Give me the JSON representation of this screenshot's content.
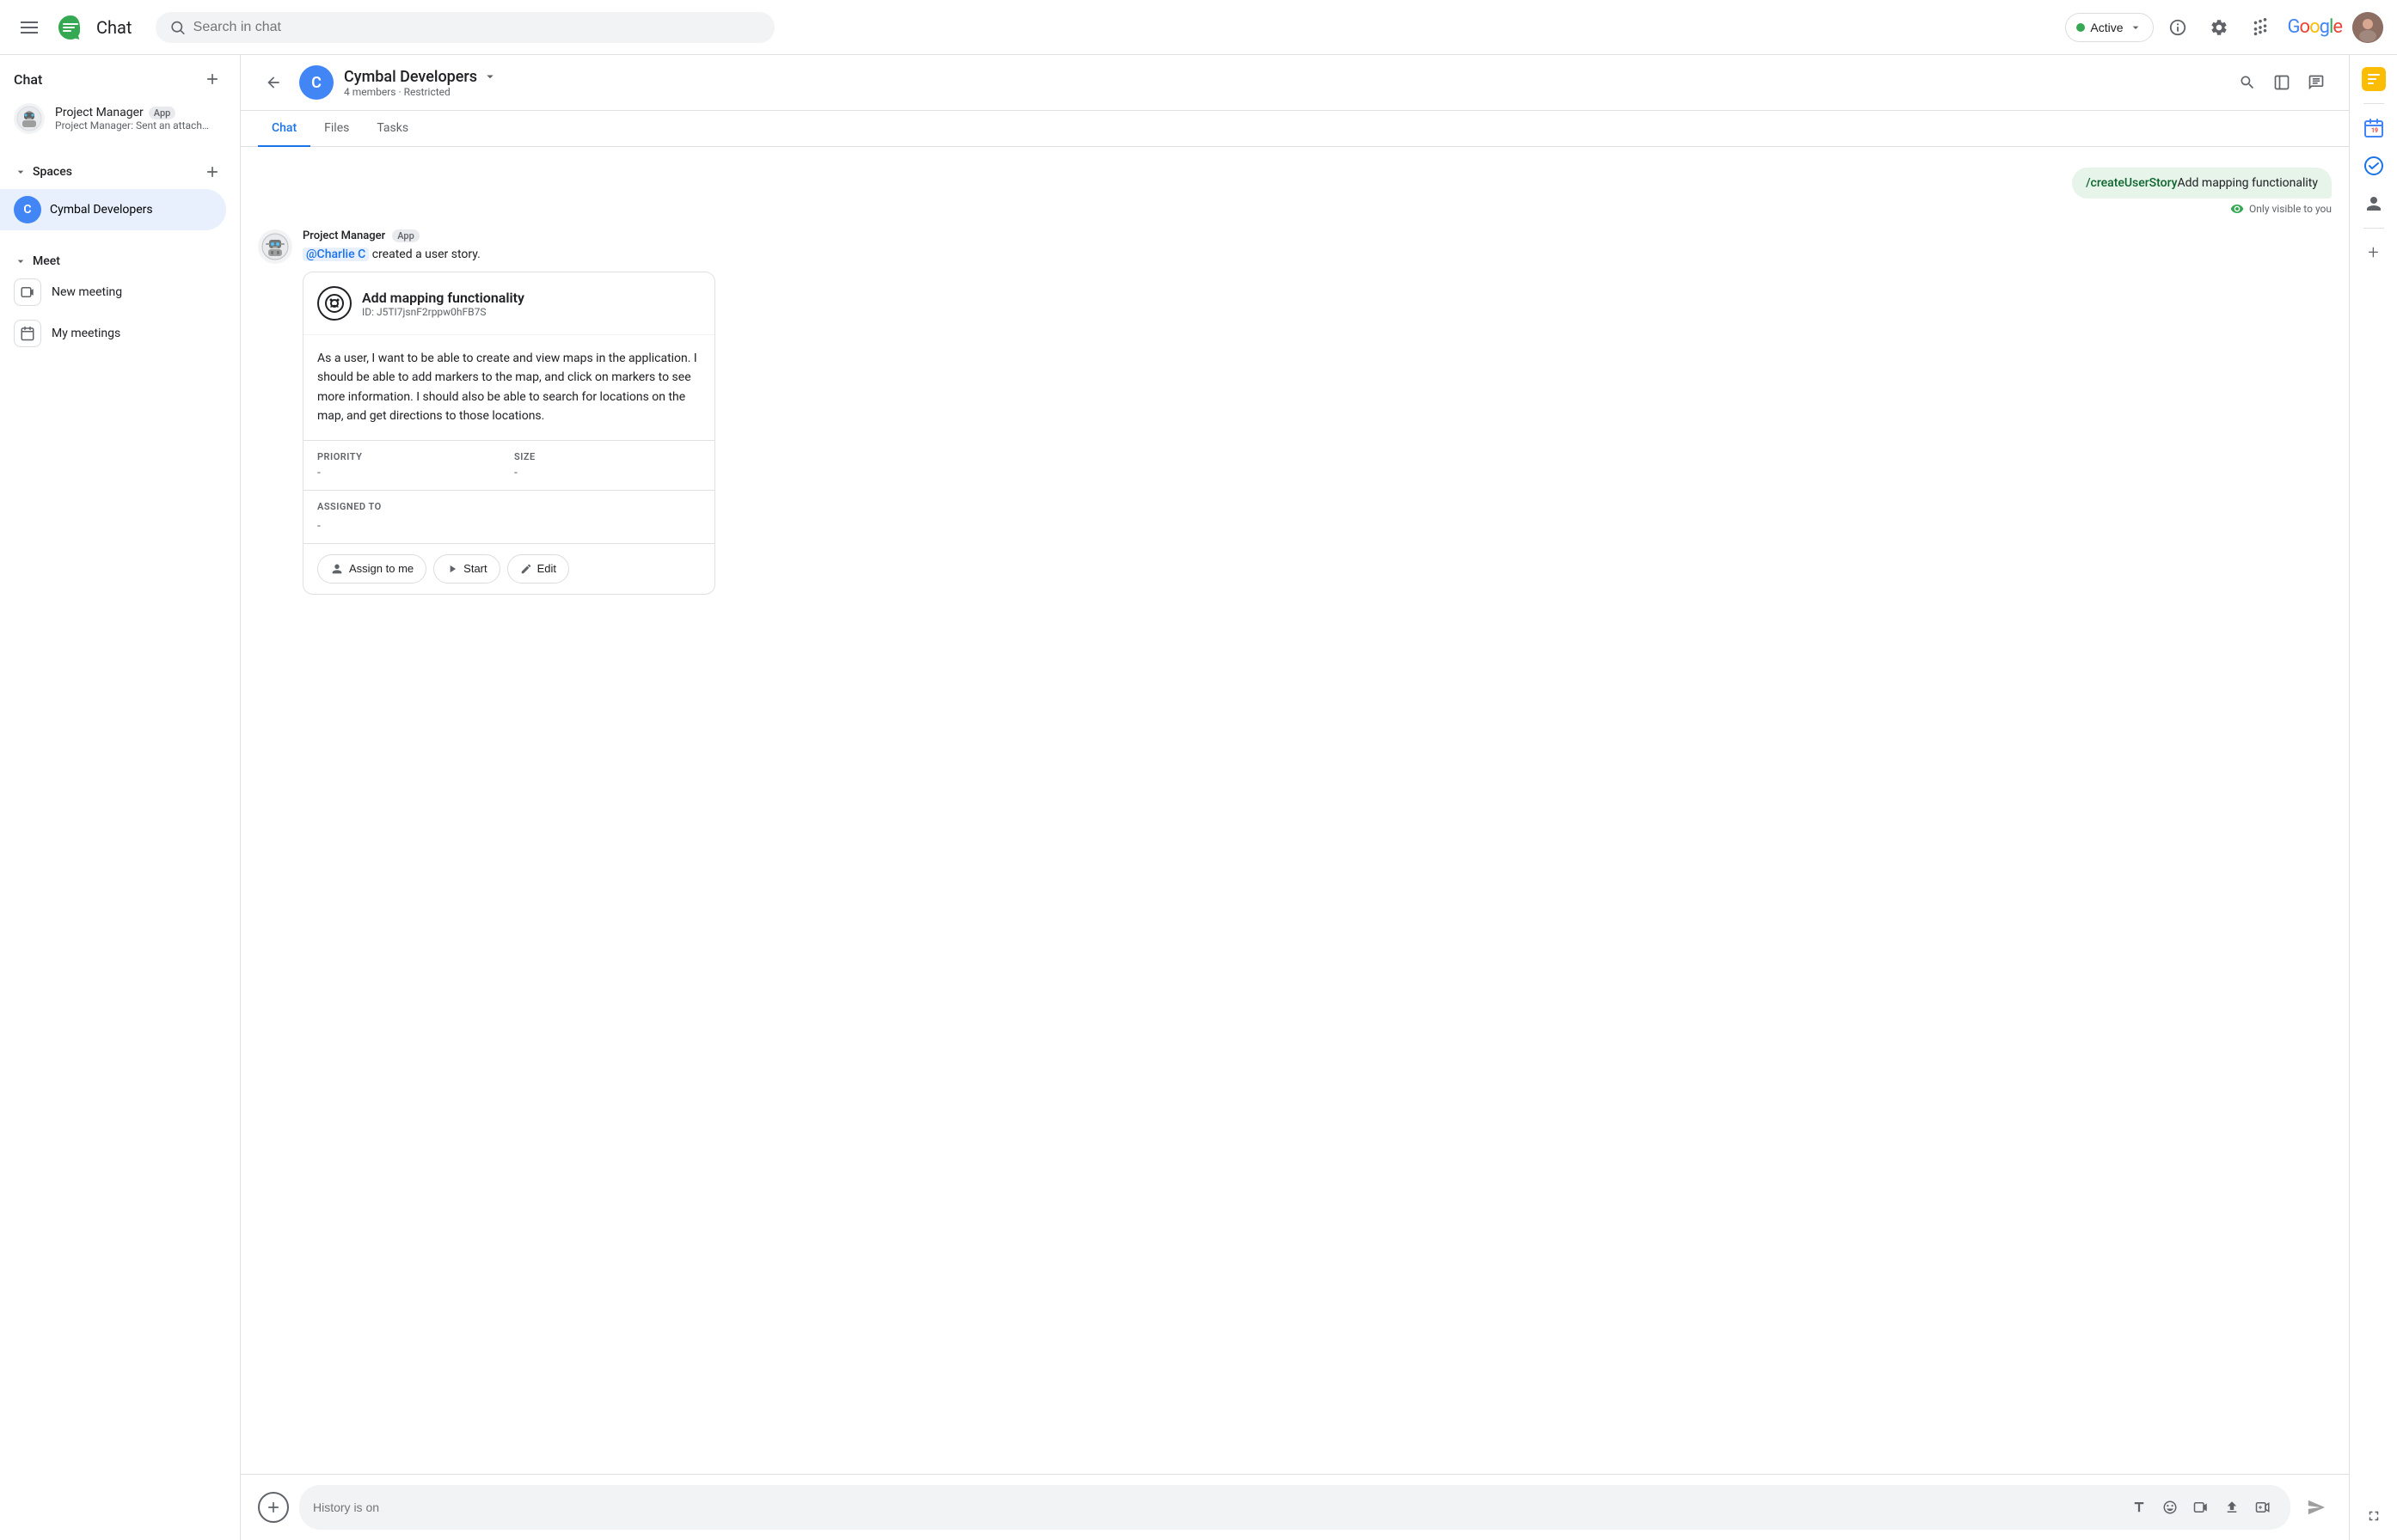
{
  "topbar": {
    "app_name": "Chat",
    "search_placeholder": "Search in chat",
    "status_label": "Active",
    "google_logo": "Google"
  },
  "sidebar": {
    "chat_label": "Chat",
    "chat_items": [
      {
        "name": "Project Manager",
        "badge": "App",
        "sub": "Project Manager: Sent an attachment"
      }
    ],
    "spaces_label": "Spaces",
    "spaces": [
      {
        "initial": "C",
        "name": "Cymbal Developers"
      }
    ],
    "meet_label": "Meet",
    "meet_items": [
      {
        "label": "New meeting"
      },
      {
        "label": "My meetings"
      }
    ]
  },
  "space_header": {
    "initial": "C",
    "name": "Cymbal Developers",
    "meta": "4 members · Restricted"
  },
  "tabs": [
    {
      "label": "Chat",
      "active": true
    },
    {
      "label": "Files",
      "active": false
    },
    {
      "label": "Tasks",
      "active": false
    }
  ],
  "messages": {
    "user_command": "/createUserStory",
    "user_command_text": "Add mapping functionality",
    "only_visible_label": "Only visible to you",
    "bot_sender": "Project Manager",
    "bot_sender_badge": "App",
    "bot_created_text": "@Charlie C created a user story.",
    "mention": "@Charlie C",
    "story": {
      "title": "Add mapping functionality",
      "id": "ID: J5TI7jsnF2rppw0hFB7S",
      "description": "As a user, I want to be able to create and view maps in the application. I should be able to add markers to the map, and click on markers to see more information. I should also be able to search for locations on the map, and get directions to those locations.",
      "priority_label": "PRIORITY",
      "priority_value": "-",
      "size_label": "SIZE",
      "size_value": "-",
      "assigned_label": "ASSIGNED TO",
      "assigned_value": "-",
      "btn_assign": "Assign to me",
      "btn_start": "Start",
      "btn_edit": "Edit"
    }
  },
  "input": {
    "placeholder": "History is on"
  }
}
